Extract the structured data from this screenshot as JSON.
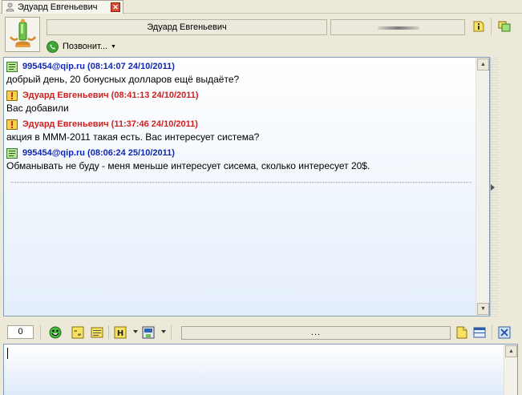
{
  "tab": {
    "title": "Эдуард Евгеньевич"
  },
  "header": {
    "contact_name": "Эдуард Евгеньевич",
    "call_label": "Позвонит..."
  },
  "messages": [
    {
      "direction": "in",
      "header": "995454@qip.ru (08:14:07 24/10/2011)",
      "text": "добрый день, 20 бонусных долларов ещё выдаёте?"
    },
    {
      "direction": "out",
      "header": "Эдуард Евгеньевич (08:41:13 24/10/2011)",
      "text": "Вас добавили"
    },
    {
      "direction": "out",
      "header": "Эдуард Евгеньевич (11:37:46 24/10/2011)",
      "text": "акция в МММ-2011 такая есть. Вас интересует система?"
    },
    {
      "direction": "in",
      "header": "995454@qip.ru (08:06:24 25/10/2011)",
      "text": "Обманывать не буду - меня меньше интересует сисема, сколько интересует 20$."
    }
  ],
  "toolbar": {
    "char_count": "0",
    "progress_text": "..."
  },
  "input": {
    "value": "",
    "placeholder": ""
  },
  "colors": {
    "incoming": "#0f27b3",
    "outgoing": "#d11e1e",
    "chat_bg_bottom": "#e4eefb"
  }
}
